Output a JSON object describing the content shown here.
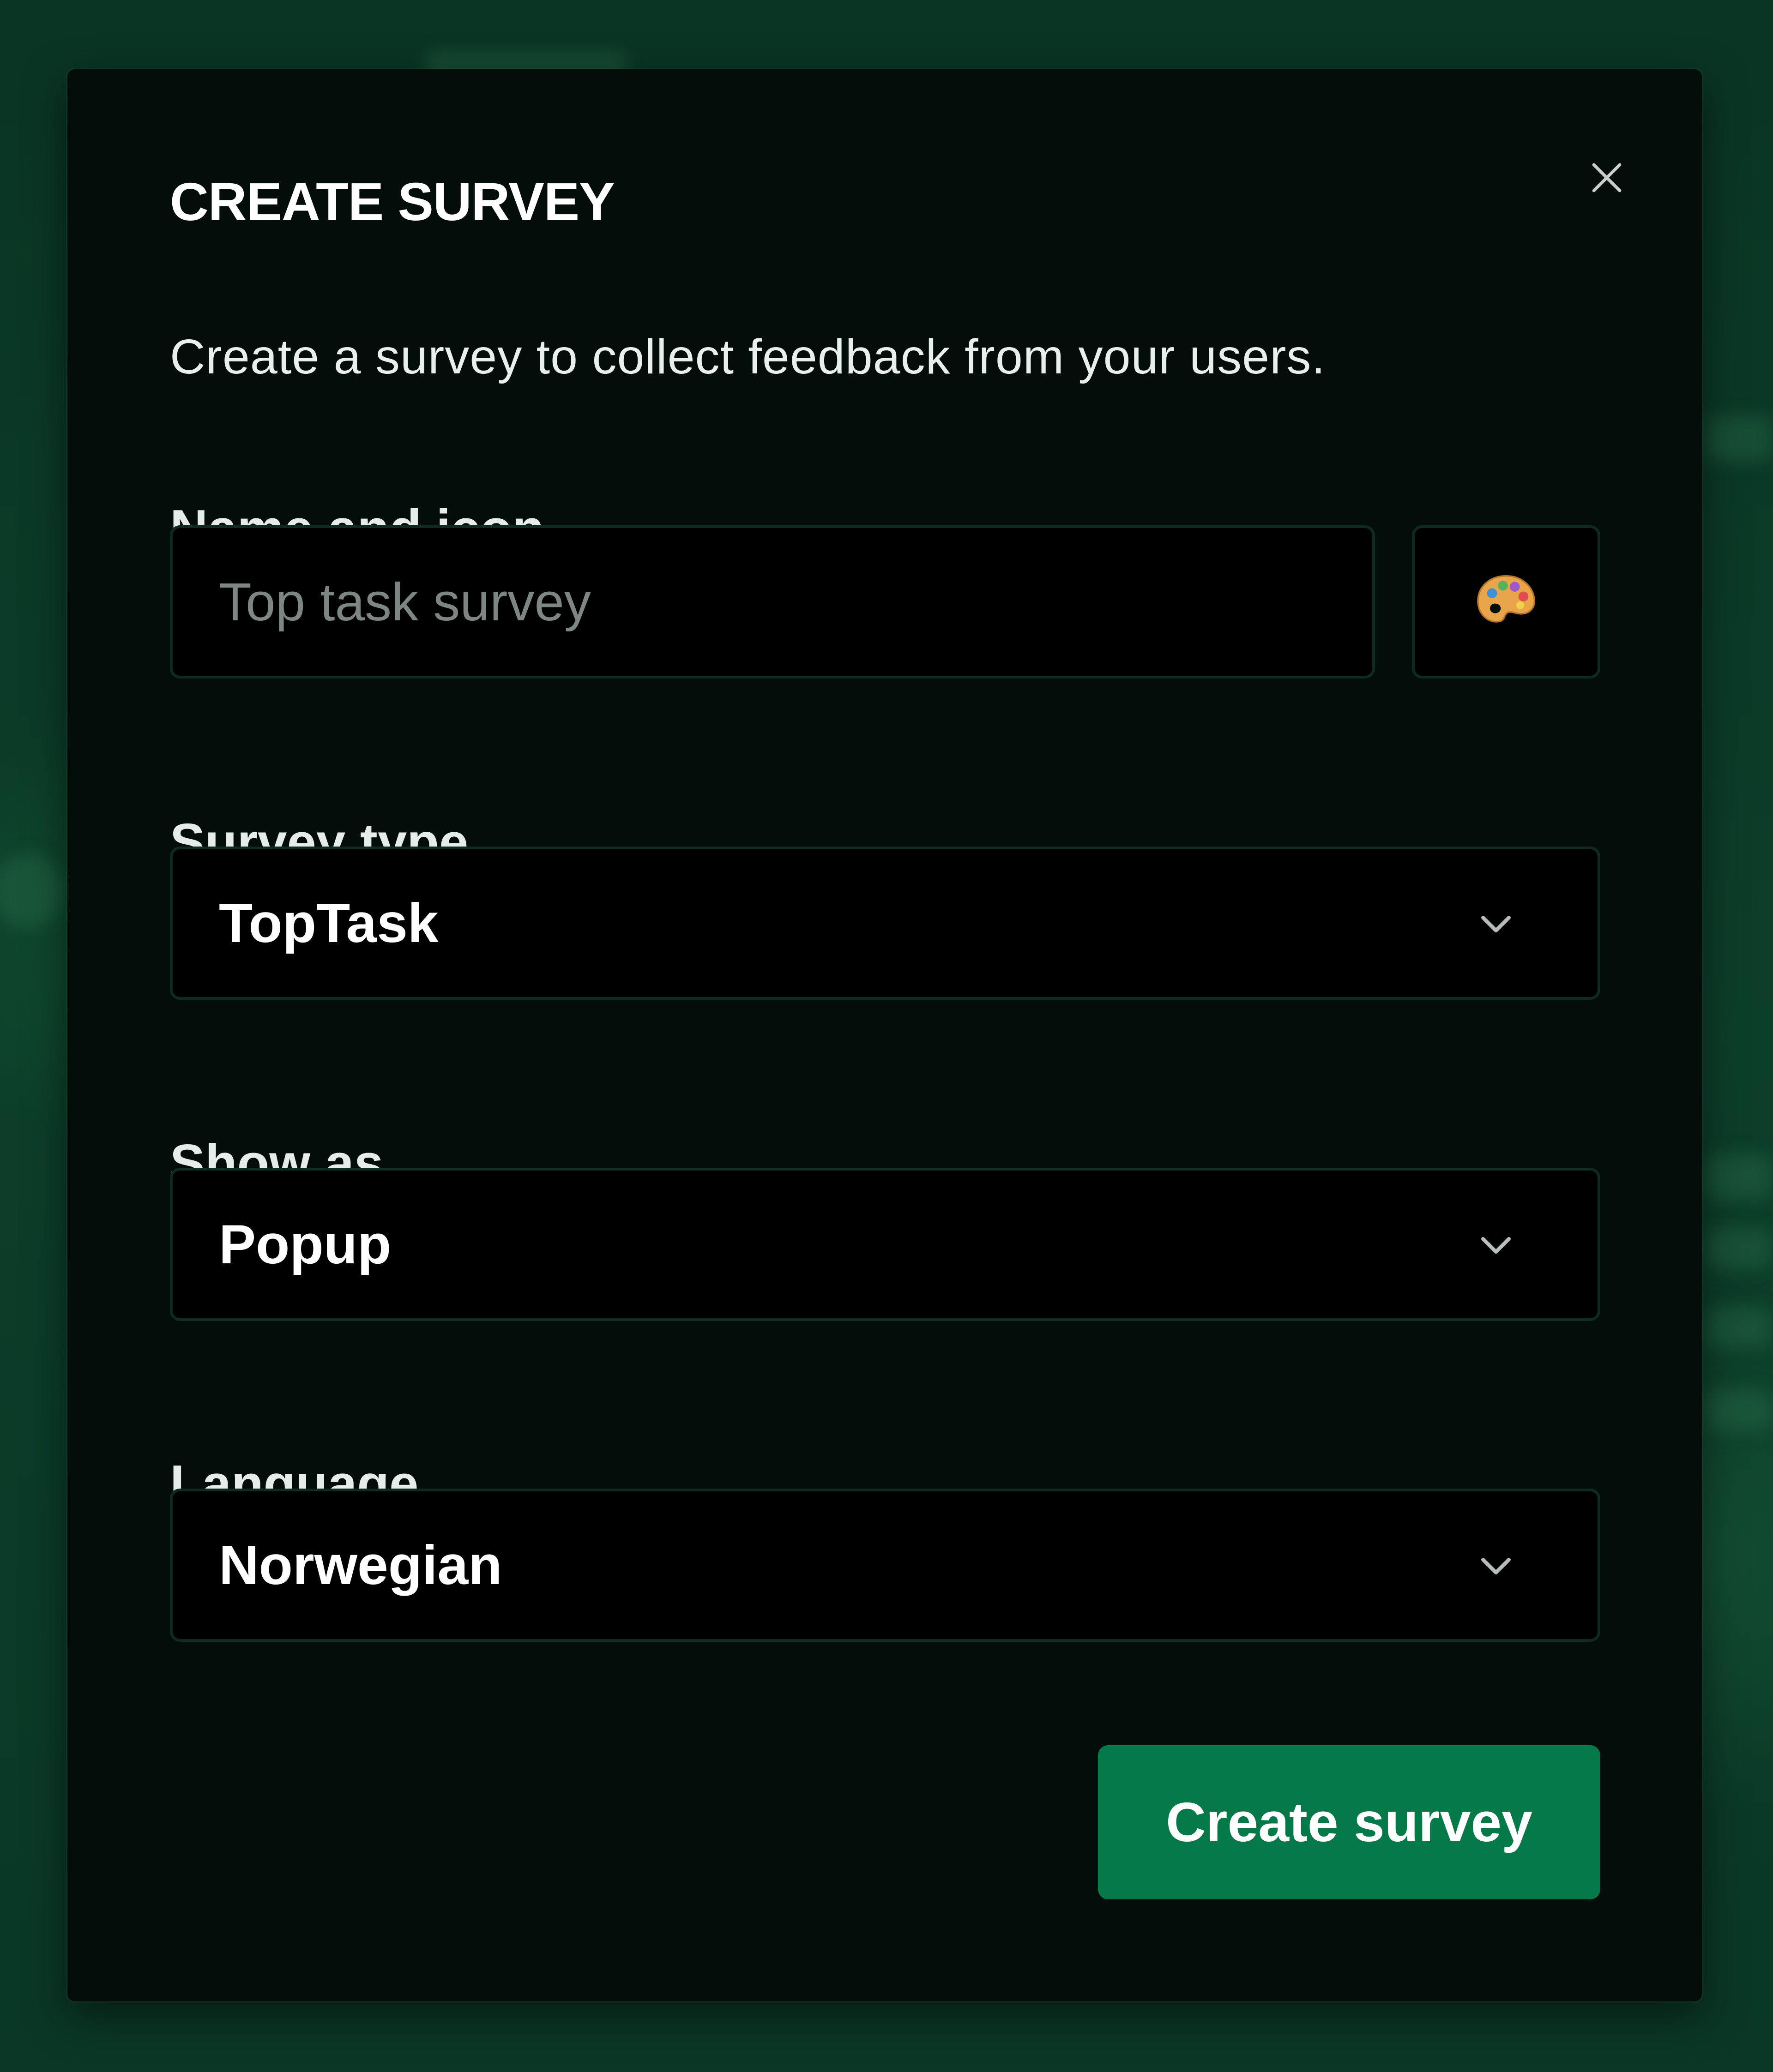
{
  "dialog": {
    "title": "CREATE SURVEY",
    "subtitle": "Create a survey to collect feedback from your users.",
    "close_icon": "close-icon"
  },
  "form": {
    "name": {
      "label": "Name and icon",
      "value": "",
      "placeholder": "Top task survey",
      "icon": "palette-icon"
    },
    "survey_type": {
      "label": "Survey type",
      "selected": "TopTask"
    },
    "show_as": {
      "label": "Show as",
      "selected": "Popup"
    },
    "language": {
      "label": "Language",
      "selected": "Norwegian"
    }
  },
  "actions": {
    "submit_label": "Create survey"
  },
  "colors": {
    "modal_background": "#030e0b",
    "field_background": "#000000",
    "field_border": "#0f2a22",
    "primary_button": "#057a48",
    "backdrop": "#0b3a27"
  }
}
